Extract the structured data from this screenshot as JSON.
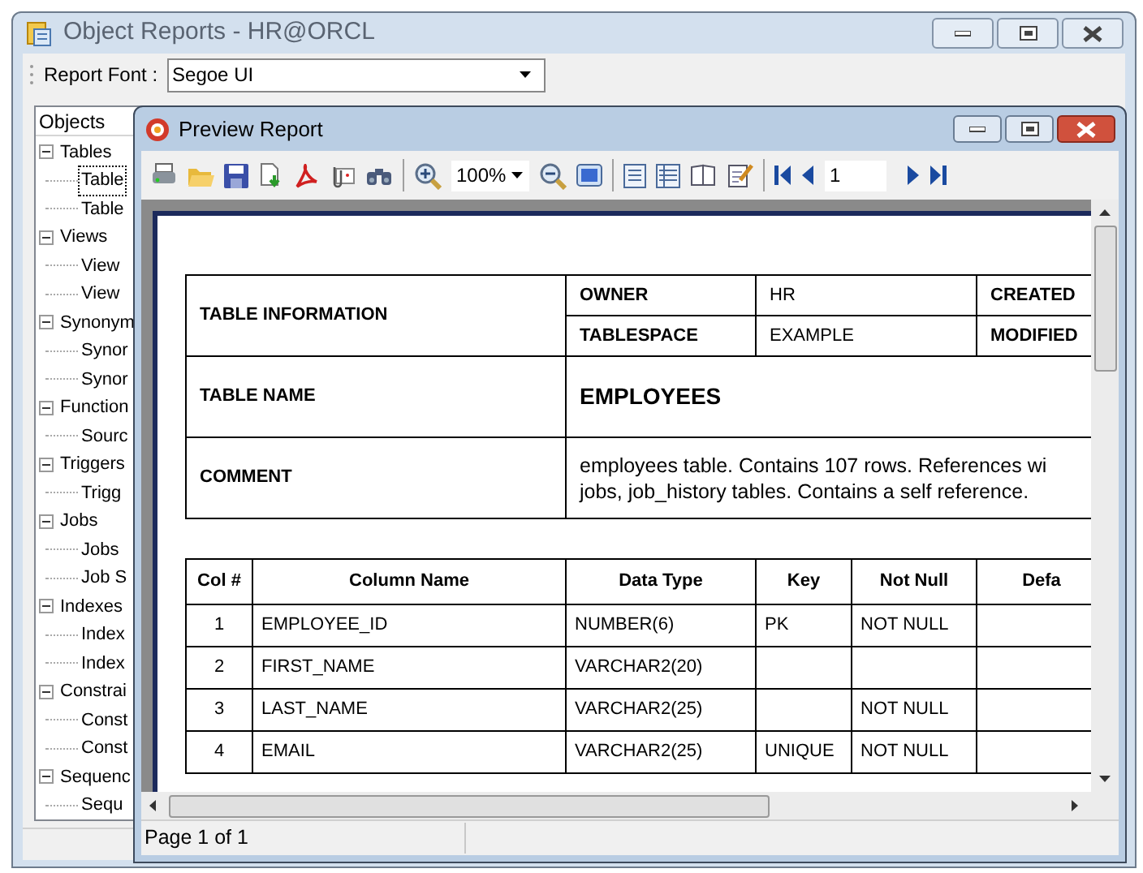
{
  "window": {
    "title": "Object Reports - HR@ORCL"
  },
  "toolbar": {
    "font_label": "Report Font :",
    "font": "Segoe UI"
  },
  "objects_panel": {
    "header": "Objects",
    "tree": [
      {
        "label": "Tables",
        "expanded": true,
        "selected": false,
        "children": [
          {
            "label": "Table",
            "selected": true
          },
          {
            "label": "Table",
            "selected": false
          }
        ]
      },
      {
        "label": "Views",
        "expanded": true,
        "selected": false,
        "children": [
          {
            "label": "View",
            "selected": false
          },
          {
            "label": "View",
            "selected": false
          }
        ]
      },
      {
        "label": "Synonym",
        "expanded": true,
        "selected": false,
        "children": [
          {
            "label": "Synor",
            "selected": false
          },
          {
            "label": "Synor",
            "selected": false
          }
        ]
      },
      {
        "label": "Function",
        "expanded": true,
        "selected": false,
        "children": [
          {
            "label": "Sourc",
            "selected": false
          }
        ]
      },
      {
        "label": "Triggers",
        "expanded": true,
        "selected": false,
        "children": [
          {
            "label": "Trigg",
            "selected": false
          }
        ]
      },
      {
        "label": "Jobs",
        "expanded": true,
        "selected": false,
        "children": [
          {
            "label": "Jobs",
            "selected": false
          },
          {
            "label": "Job S",
            "selected": false
          }
        ]
      },
      {
        "label": "Indexes",
        "expanded": true,
        "selected": false,
        "children": [
          {
            "label": "Index",
            "selected": false
          },
          {
            "label": "Index",
            "selected": false
          }
        ]
      },
      {
        "label": "Constrai",
        "expanded": true,
        "selected": false,
        "children": [
          {
            "label": "Const",
            "selected": false
          },
          {
            "label": "Const",
            "selected": false
          }
        ]
      },
      {
        "label": "Sequenc",
        "expanded": true,
        "selected": false,
        "children": [
          {
            "label": "Sequ",
            "selected": false
          }
        ]
      }
    ]
  },
  "preview": {
    "title": "Preview Report",
    "zoom": "100%",
    "page_input": "1",
    "status": "Page 1 of 1",
    "report": {
      "table_information": {
        "label": "TABLE INFORMATION",
        "rows": [
          {
            "key": "OWNER",
            "value": "HR",
            "key_2": "CREATED"
          },
          {
            "key": "TABLESPACE",
            "value": "EXAMPLE",
            "key_2": "MODIFIED"
          }
        ]
      },
      "table_name": {
        "label": "TABLE NAME",
        "value": "EMPLOYEES"
      },
      "comment": {
        "label": "COMMENT",
        "value": "employees table. Contains 107 rows. References wi\njobs, job_history tables. Contains a self reference."
      },
      "columns": [
        "Col #",
        "Column Name",
        "Data Type",
        "Key",
        "Not Null",
        "Defa"
      ],
      "rows": [
        {
          "col_no": "1",
          "column_name": "EMPLOYEE_ID",
          "data_type": "NUMBER(6)",
          "key": "PK",
          "not_null": "NOT NULL"
        },
        {
          "col_no": "2",
          "column_name": "FIRST_NAME",
          "data_type": "VARCHAR2(20)"
        },
        {
          "col_no": "3",
          "column_name": "LAST_NAME",
          "data_type": "VARCHAR2(25)",
          "not_null": "NOT NULL"
        },
        {
          "col_no": "4",
          "column_name": "EMAIL",
          "data_type": "VARCHAR2(25)",
          "key": "UNIQUE",
          "not_null": "NOT NULL"
        }
      ]
    }
  }
}
